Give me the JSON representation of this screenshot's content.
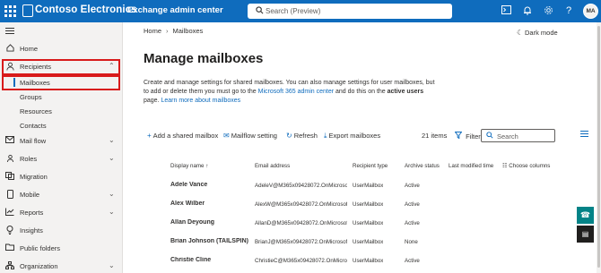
{
  "topbar": {
    "brand": "Contoso Electronics",
    "app_name": "Exchange admin center",
    "search_placeholder": "Search (Preview)",
    "avatar_initials": "MA",
    "brand_color": "#0f6cbd"
  },
  "sidebar": {
    "items": [
      {
        "label": "Home",
        "icon": "home-icon"
      },
      {
        "label": "Recipients",
        "icon": "person-icon"
      },
      {
        "label": "Mail flow",
        "icon": "mail-icon"
      },
      {
        "label": "Roles",
        "icon": "roles-icon"
      },
      {
        "label": "Migration",
        "icon": "migration-icon"
      },
      {
        "label": "Mobile",
        "icon": "mobile-icon"
      },
      {
        "label": "Reports",
        "icon": "reports-icon"
      },
      {
        "label": "Insights",
        "icon": "insights-icon"
      },
      {
        "label": "Public folders",
        "icon": "folder-icon"
      },
      {
        "label": "Organization",
        "icon": "organization-icon"
      }
    ],
    "subitems": [
      "Mailboxes",
      "Groups",
      "Resources",
      "Contacts"
    ]
  },
  "breadcrumb": {
    "home": "Home",
    "current": "Mailboxes"
  },
  "dark_mode_label": "Dark mode",
  "page_title": "Manage mailboxes",
  "description": {
    "part1": "Create and manage settings for shared mailboxes. You can also manage settings for user mailboxes, but to add or delete them you must go to the ",
    "link1": "Microsoft 365 admin center",
    "part2": " and do this on the ",
    "bold": "active users",
    "part3": " page. ",
    "link2": "Learn more about mailboxes"
  },
  "toolbar": {
    "add_shared": "Add a shared mailbox",
    "mailflow": "Mailflow setting",
    "refresh": "Refresh",
    "export": "Export mailboxes",
    "count": "21 items",
    "filter": "Filter",
    "search_placeholder": "Search"
  },
  "table": {
    "headers": {
      "display_name": "Display name",
      "email": "Email address",
      "recipient_type": "Recipient type",
      "archive_status": "Archive status",
      "last_modified": "Last modified time",
      "choose_columns": "Choose columns"
    },
    "rows": [
      {
        "name": "Adele Vance",
        "email": "AdeleV@M365x09428072.OnMicrosoft.",
        "type": "UserMailbox",
        "archive": "Active"
      },
      {
        "name": "Alex Wilber",
        "email": "AlexW@M365x09428072.OnMicrosoft.c",
        "type": "UserMailbox",
        "archive": "Active"
      },
      {
        "name": "Allan Deyoung",
        "email": "AllanD@M365x09428072.OnMicrosoft.",
        "type": "UserMailbox",
        "archive": "Active"
      },
      {
        "name": "Brian Johnson (TAILSPIN)",
        "email": "BrianJ@M365x09428072.OnMicrosoft.",
        "type": "UserMailbox",
        "archive": "None"
      },
      {
        "name": "Christie Cline",
        "email": "ChristieC@M365x09428072.OnMicroso",
        "type": "UserMailbox",
        "archive": "Active"
      }
    ]
  }
}
